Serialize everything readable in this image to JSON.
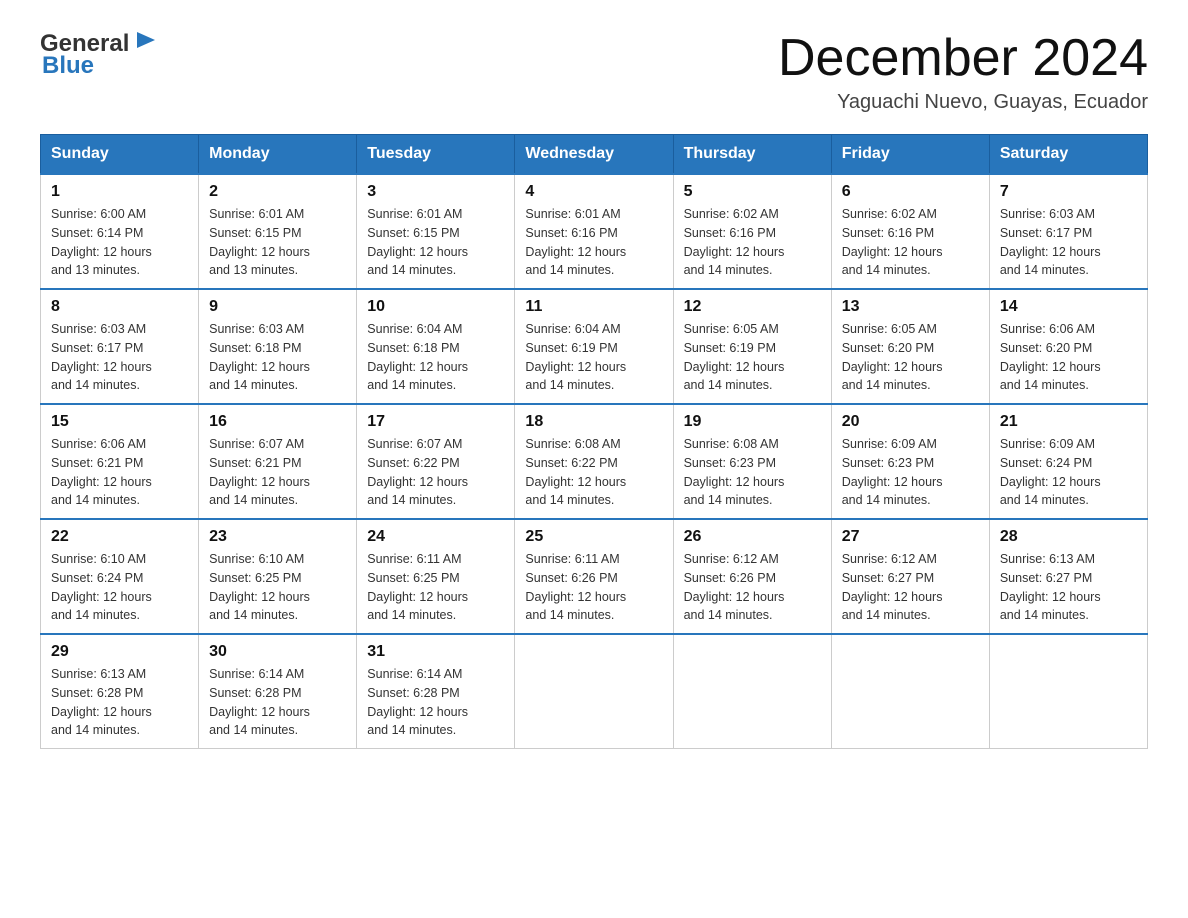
{
  "header": {
    "logo_general": "General",
    "logo_blue": "Blue",
    "month_title": "December 2024",
    "subtitle": "Yaguachi Nuevo, Guayas, Ecuador"
  },
  "days_of_week": [
    "Sunday",
    "Monday",
    "Tuesday",
    "Wednesday",
    "Thursday",
    "Friday",
    "Saturday"
  ],
  "weeks": [
    [
      {
        "day": "1",
        "sunrise": "6:00 AM",
        "sunset": "6:14 PM",
        "daylight": "12 hours and 13 minutes."
      },
      {
        "day": "2",
        "sunrise": "6:01 AM",
        "sunset": "6:15 PM",
        "daylight": "12 hours and 13 minutes."
      },
      {
        "day": "3",
        "sunrise": "6:01 AM",
        "sunset": "6:15 PM",
        "daylight": "12 hours and 14 minutes."
      },
      {
        "day": "4",
        "sunrise": "6:01 AM",
        "sunset": "6:16 PM",
        "daylight": "12 hours and 14 minutes."
      },
      {
        "day": "5",
        "sunrise": "6:02 AM",
        "sunset": "6:16 PM",
        "daylight": "12 hours and 14 minutes."
      },
      {
        "day": "6",
        "sunrise": "6:02 AM",
        "sunset": "6:16 PM",
        "daylight": "12 hours and 14 minutes."
      },
      {
        "day": "7",
        "sunrise": "6:03 AM",
        "sunset": "6:17 PM",
        "daylight": "12 hours and 14 minutes."
      }
    ],
    [
      {
        "day": "8",
        "sunrise": "6:03 AM",
        "sunset": "6:17 PM",
        "daylight": "12 hours and 14 minutes."
      },
      {
        "day": "9",
        "sunrise": "6:03 AM",
        "sunset": "6:18 PM",
        "daylight": "12 hours and 14 minutes."
      },
      {
        "day": "10",
        "sunrise": "6:04 AM",
        "sunset": "6:18 PM",
        "daylight": "12 hours and 14 minutes."
      },
      {
        "day": "11",
        "sunrise": "6:04 AM",
        "sunset": "6:19 PM",
        "daylight": "12 hours and 14 minutes."
      },
      {
        "day": "12",
        "sunrise": "6:05 AM",
        "sunset": "6:19 PM",
        "daylight": "12 hours and 14 minutes."
      },
      {
        "day": "13",
        "sunrise": "6:05 AM",
        "sunset": "6:20 PM",
        "daylight": "12 hours and 14 minutes."
      },
      {
        "day": "14",
        "sunrise": "6:06 AM",
        "sunset": "6:20 PM",
        "daylight": "12 hours and 14 minutes."
      }
    ],
    [
      {
        "day": "15",
        "sunrise": "6:06 AM",
        "sunset": "6:21 PM",
        "daylight": "12 hours and 14 minutes."
      },
      {
        "day": "16",
        "sunrise": "6:07 AM",
        "sunset": "6:21 PM",
        "daylight": "12 hours and 14 minutes."
      },
      {
        "day": "17",
        "sunrise": "6:07 AM",
        "sunset": "6:22 PM",
        "daylight": "12 hours and 14 minutes."
      },
      {
        "day": "18",
        "sunrise": "6:08 AM",
        "sunset": "6:22 PM",
        "daylight": "12 hours and 14 minutes."
      },
      {
        "day": "19",
        "sunrise": "6:08 AM",
        "sunset": "6:23 PM",
        "daylight": "12 hours and 14 minutes."
      },
      {
        "day": "20",
        "sunrise": "6:09 AM",
        "sunset": "6:23 PM",
        "daylight": "12 hours and 14 minutes."
      },
      {
        "day": "21",
        "sunrise": "6:09 AM",
        "sunset": "6:24 PM",
        "daylight": "12 hours and 14 minutes."
      }
    ],
    [
      {
        "day": "22",
        "sunrise": "6:10 AM",
        "sunset": "6:24 PM",
        "daylight": "12 hours and 14 minutes."
      },
      {
        "day": "23",
        "sunrise": "6:10 AM",
        "sunset": "6:25 PM",
        "daylight": "12 hours and 14 minutes."
      },
      {
        "day": "24",
        "sunrise": "6:11 AM",
        "sunset": "6:25 PM",
        "daylight": "12 hours and 14 minutes."
      },
      {
        "day": "25",
        "sunrise": "6:11 AM",
        "sunset": "6:26 PM",
        "daylight": "12 hours and 14 minutes."
      },
      {
        "day": "26",
        "sunrise": "6:12 AM",
        "sunset": "6:26 PM",
        "daylight": "12 hours and 14 minutes."
      },
      {
        "day": "27",
        "sunrise": "6:12 AM",
        "sunset": "6:27 PM",
        "daylight": "12 hours and 14 minutes."
      },
      {
        "day": "28",
        "sunrise": "6:13 AM",
        "sunset": "6:27 PM",
        "daylight": "12 hours and 14 minutes."
      }
    ],
    [
      {
        "day": "29",
        "sunrise": "6:13 AM",
        "sunset": "6:28 PM",
        "daylight": "12 hours and 14 minutes."
      },
      {
        "day": "30",
        "sunrise": "6:14 AM",
        "sunset": "6:28 PM",
        "daylight": "12 hours and 14 minutes."
      },
      {
        "day": "31",
        "sunrise": "6:14 AM",
        "sunset": "6:28 PM",
        "daylight": "12 hours and 14 minutes."
      },
      null,
      null,
      null,
      null
    ]
  ],
  "labels": {
    "sunrise": "Sunrise:",
    "sunset": "Sunset:",
    "daylight": "Daylight:"
  }
}
